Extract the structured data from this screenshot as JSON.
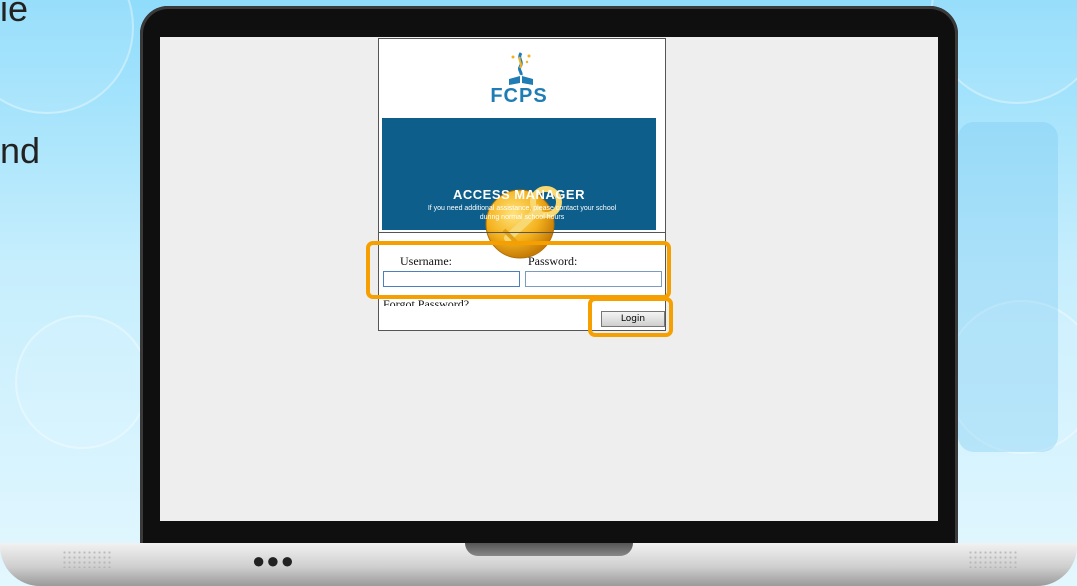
{
  "slide": {
    "partial_text_top": "ie",
    "partial_text_mid": "nd"
  },
  "login": {
    "logo_text": "FCPS",
    "title": "ACCESS MANAGER",
    "subtitle": "If you need additional assistance, please contact your school during normal school hours",
    "username_label": "Username:",
    "password_label": "Password:",
    "username_value": "",
    "password_value": "",
    "forgot_link": "Forgot Password?",
    "login_button": "Login"
  },
  "laptop": {
    "dots": "●●●"
  },
  "colors": {
    "highlight": "#f5a000",
    "banner_blue": "#0d5e8a",
    "brand_blue": "#1f7cb5"
  }
}
